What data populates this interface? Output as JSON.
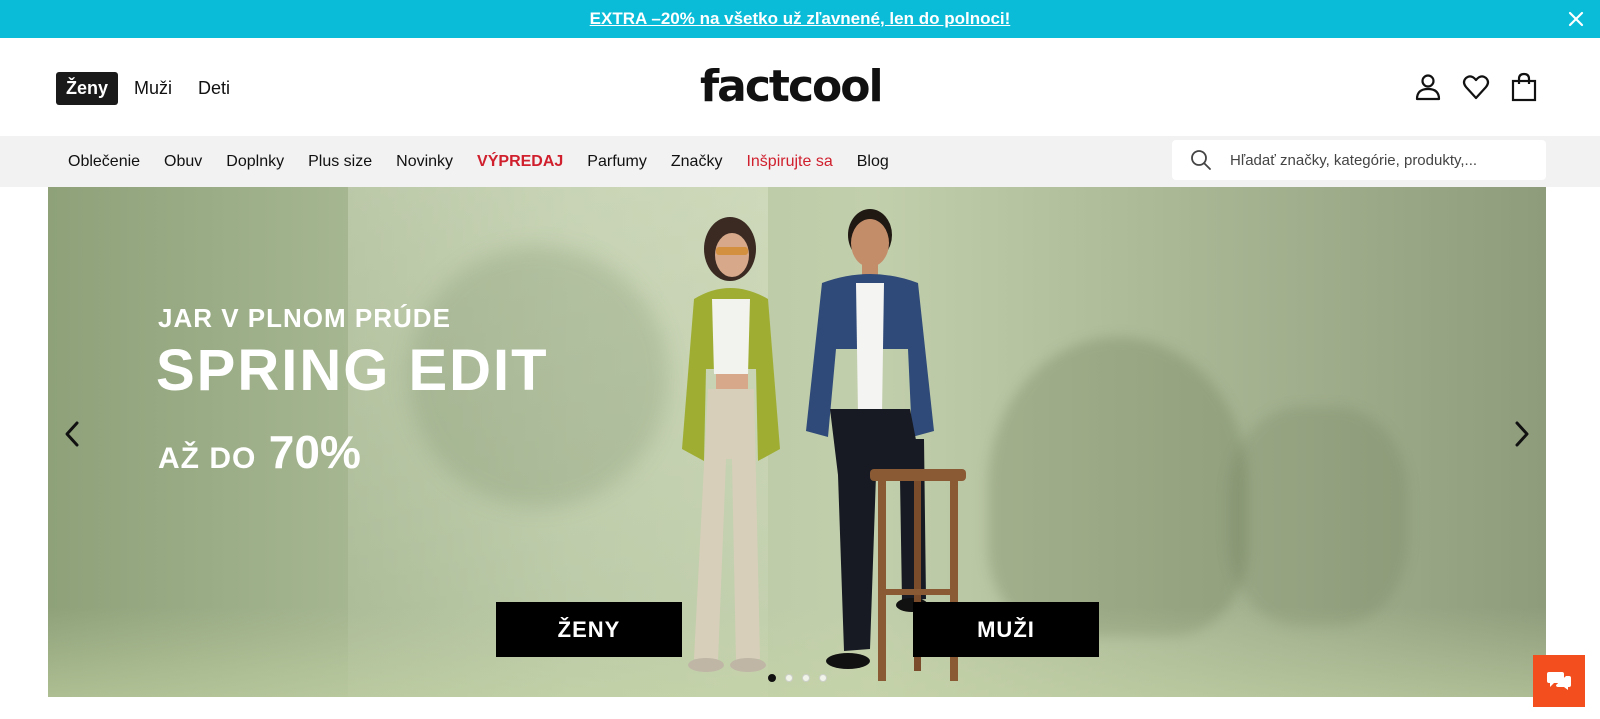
{
  "promo": {
    "text": "EXTRA –20% na všetko už zľavnené, len do polnoci!",
    "close_icon": "close-icon",
    "background": "#0abcd8"
  },
  "header": {
    "gender_tabs": [
      {
        "label": "Ženy",
        "active": true
      },
      {
        "label": "Muži",
        "active": false
      },
      {
        "label": "Deti",
        "active": false
      }
    ],
    "logo": "factcool",
    "icons": [
      "user-icon",
      "heart-icon",
      "bag-icon"
    ]
  },
  "nav": {
    "items": [
      {
        "label": "Oblečenie"
      },
      {
        "label": "Obuv"
      },
      {
        "label": "Doplnky"
      },
      {
        "label": "Plus size"
      },
      {
        "label": "Novinky"
      },
      {
        "label": "VÝPREDAJ"
      },
      {
        "label": "Parfumy"
      },
      {
        "label": "Značky"
      },
      {
        "label": "Inšpirujte sa"
      },
      {
        "label": "Blog"
      }
    ],
    "search_placeholder": "Hľadať značky, kategórie, produkty,...",
    "sale_color": "#d0202e"
  },
  "hero": {
    "subtitle": "JAR V PLNOM PRÚDE",
    "title": "SPRING EDIT",
    "discount_prefix": "AŽ DO",
    "discount_value": "70%",
    "cta_women": "ŽENY",
    "cta_men": "MUŽI",
    "slides_total": 4,
    "active_slide": 1
  },
  "chat": {
    "icon": "chat-icon",
    "color": "#f24e1e"
  }
}
